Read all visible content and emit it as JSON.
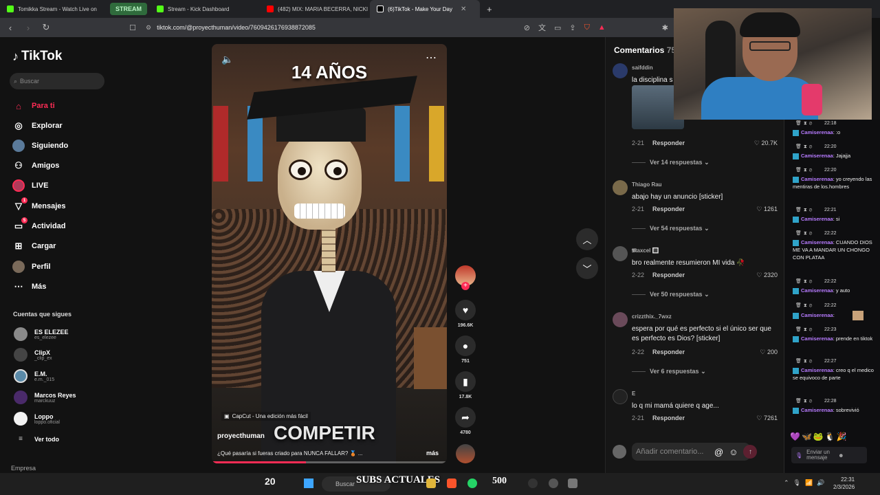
{
  "browser": {
    "tabs": [
      {
        "label": "Tomikka Stream - Watch Live on",
        "color": "#53fc18"
      },
      {
        "label": "STREAM",
        "color": "#53fc18"
      },
      {
        "label": "Stream - Kick Dashboard",
        "color": "#53fc18"
      },
      {
        "label": "(482) MIX: MARIA BECERRA, NICKI N",
        "color": "#ff0000"
      },
      {
        "label": "(6)TikTok - Make Your Day",
        "color": "#ffffff"
      }
    ],
    "url": "tiktok.com/@proyecthuman/video/7609426176938872085"
  },
  "sidebar": {
    "logo": "TikTok",
    "search_placeholder": "Buscar",
    "nav": [
      {
        "label": "Para ti",
        "icon": "home-icon",
        "active": true
      },
      {
        "label": "Explorar",
        "icon": "compass-icon"
      },
      {
        "label": "Siguiendo",
        "icon": "following-avatar-icon"
      },
      {
        "label": "Amigos",
        "icon": "friends-icon"
      },
      {
        "label": "LIVE",
        "icon": "live-icon"
      },
      {
        "label": "Mensajes",
        "icon": "paper-plane-icon",
        "badge": "1"
      },
      {
        "label": "Actividad",
        "icon": "activity-icon",
        "badge": "5"
      },
      {
        "label": "Cargar",
        "icon": "upload-icon"
      },
      {
        "label": "Perfil",
        "icon": "profile-icon"
      },
      {
        "label": "Más",
        "icon": "more-icon"
      }
    ],
    "following_title": "Cuentas que sigues",
    "accounts": [
      {
        "name": "ES ELEZEE",
        "handle": "es_elezee"
      },
      {
        "name": "ClipX",
        "handle": "_clip_ex"
      },
      {
        "name": "E.M.",
        "handle": "e.m._015"
      },
      {
        "name": "Marcos Reyes",
        "handle": "marckuuz"
      },
      {
        "name": "Loppo",
        "handle": "loppo.oficial"
      }
    ],
    "see_all": "Ver todo",
    "footer": "Empresa"
  },
  "video": {
    "title": "14 AÑOS",
    "capcut_label": "CapCut - Una edición más fácil",
    "overlay_text": "COMPETIR",
    "author": "proyecthuman",
    "description": "¿Qué pasaría si fueras criado para NUNCA FALLAR? 🥉 ...",
    "more": "más",
    "progress": 0.4
  },
  "actions": {
    "likes": "196.6K",
    "comments": "751",
    "saves": "17.8K",
    "shares": "4780"
  },
  "comments": {
    "title": "Comentarios",
    "count": "75",
    "reply_label": "Responder",
    "items": [
      {
        "user": "saifddin",
        "text": "la disciplina s",
        "date": "2-21",
        "likes": "20.7K",
        "replies": "Ver 14 respuestas"
      },
      {
        "user": "Thiago Rau",
        "text": "abajo hay un anuncio [sticker]",
        "date": "2-21",
        "likes": "1261",
        "replies": "Ver 54 respuestas"
      },
      {
        "user": "𝕸axcel 🔳",
        "text": "bro realmente resumieron MI vida 🥀",
        "date": "2-22",
        "likes": "2320",
        "replies": "Ver 50 respuestas"
      },
      {
        "user": "crizzthix._7wxz",
        "text": "espera por qué es perfecto si el único ser que es perfecto es Dios? [sticker]",
        "date": "2-22",
        "likes": "200",
        "replies": "Ver 6 respuestas"
      },
      {
        "user": "E",
        "text": "lo q mi mamá quiere q age...",
        "date": "2-21",
        "likes": "7261",
        "replies": ""
      }
    ],
    "input_placeholder": "Añadir comentario..."
  },
  "chat": {
    "messages": [
      {
        "time": "22:18",
        "user": "Camiserenaa",
        "text": ":o"
      },
      {
        "time": "22:20",
        "user": "Camiserenaa",
        "text": "Jajajja"
      },
      {
        "time": "22:20",
        "user": "Camiserenaa",
        "text": "yo creyendo las mentiras de los.hombres"
      },
      {
        "time": "22:21",
        "user": "Camiserenaa",
        "text": "si"
      },
      {
        "time": "22:22",
        "user": "Camiserenaa",
        "text": "CUANDO DIOS ME VA A MANDAR UN CHONGO CON PLATAA"
      },
      {
        "time": "22:22",
        "user": "Camiserenaa",
        "text": "y auto"
      },
      {
        "time": "22:22",
        "user": "Camiserenaa",
        "text": ""
      },
      {
        "time": "22:23",
        "user": "Camiserenaa",
        "text": "prende en tiktok"
      },
      {
        "time": "22:27",
        "user": "Camiserenaa",
        "text": "creo q el medico se equivoco de parte"
      },
      {
        "time": "22:28",
        "user": "Camiserenaa",
        "text": "sobrevivió"
      }
    ],
    "input_placeholder": "Enviar un mensaje"
  },
  "taskbar": {
    "zoom": "20",
    "search": "Buscar",
    "subs_label": "SUBS ACTUALES",
    "subs_count": "500",
    "time": "22:31",
    "date": "2/3/2026"
  }
}
